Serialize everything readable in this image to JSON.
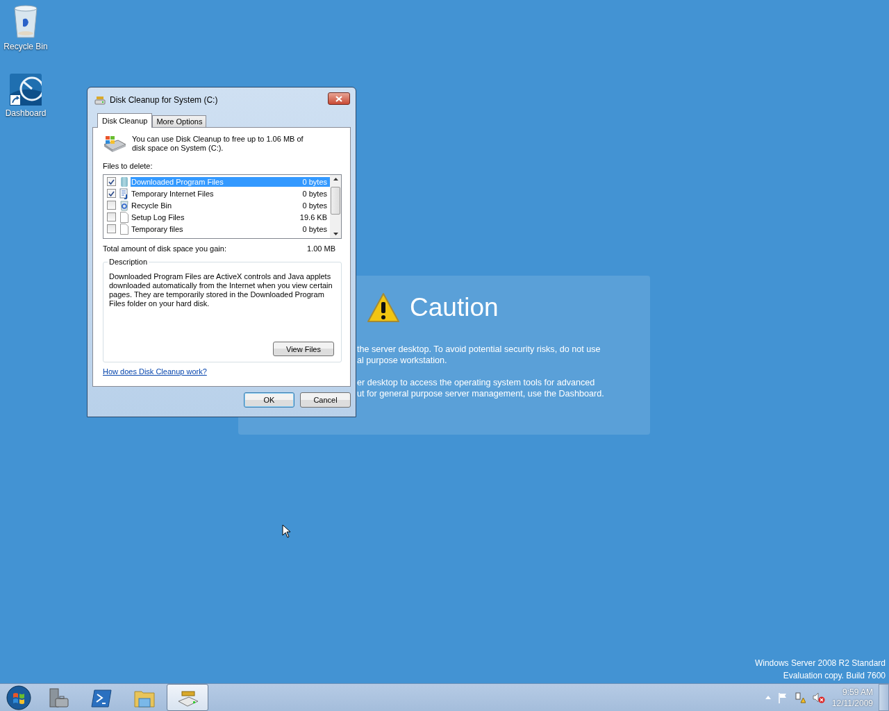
{
  "desktop_icons": [
    {
      "label": "Recycle Bin",
      "kind": "recycle"
    },
    {
      "label": "Dashboard",
      "kind": "dashboard"
    }
  ],
  "caution": {
    "title": "Caution",
    "paragraphs": [
      [
        "the server desktop. To avoid potential security risks, do not use",
        "al purpose workstation."
      ],
      [
        "er desktop to access the operating system tools for advanced",
        "ut for general purpose server management, use the Dashboard."
      ]
    ]
  },
  "dialog": {
    "title": "Disk Cleanup for System (C:)",
    "tabs": [
      {
        "label": "Disk Cleanup",
        "selected": true
      },
      {
        "label": "More Options",
        "selected": false
      }
    ],
    "intro": "You can use Disk Cleanup to free up to 1.06 MB of disk space on System (C:).",
    "files_label": "Files to delete:",
    "files": [
      {
        "name": "Downloaded Program Files",
        "size": "0 bytes",
        "checked": true,
        "selected": true,
        "kind": "folder"
      },
      {
        "name": "Temporary Internet Files",
        "size": "0 bytes",
        "checked": true,
        "selected": false,
        "kind": "document"
      },
      {
        "name": "Recycle Bin",
        "size": "0 bytes",
        "checked": false,
        "selected": false,
        "kind": "recycle"
      },
      {
        "name": "Setup Log Files",
        "size": "19.6 KB",
        "checked": false,
        "selected": false,
        "kind": "blank"
      },
      {
        "name": "Temporary files",
        "size": "0 bytes",
        "checked": false,
        "selected": false,
        "kind": "blank"
      }
    ],
    "total_label": "Total amount of disk space you gain:",
    "total_value": "1.00 MB",
    "description_title": "Description",
    "description": "Downloaded Program Files are ActiveX controls and Java applets downloaded automatically from the Internet when you view certain pages. They are temporarily stored in the Downloaded Program Files folder on your hard disk.",
    "view_files_button": "View Files",
    "help_link": "How does Disk Cleanup work?",
    "buttons": [
      "OK",
      "Cancel"
    ]
  },
  "edition": [
    "Windows Server 2008 R2 Standard",
    "Evaluation copy. Build 7600"
  ],
  "taskbar": {
    "items": [
      {
        "kind": "server",
        "selected": false
      },
      {
        "kind": "shell",
        "selected": false
      },
      {
        "kind": "explorer",
        "selected": false
      },
      {
        "kind": "cleanup",
        "selected": true
      }
    ],
    "time": "9:59 AM",
    "date": "12/11/2009"
  }
}
